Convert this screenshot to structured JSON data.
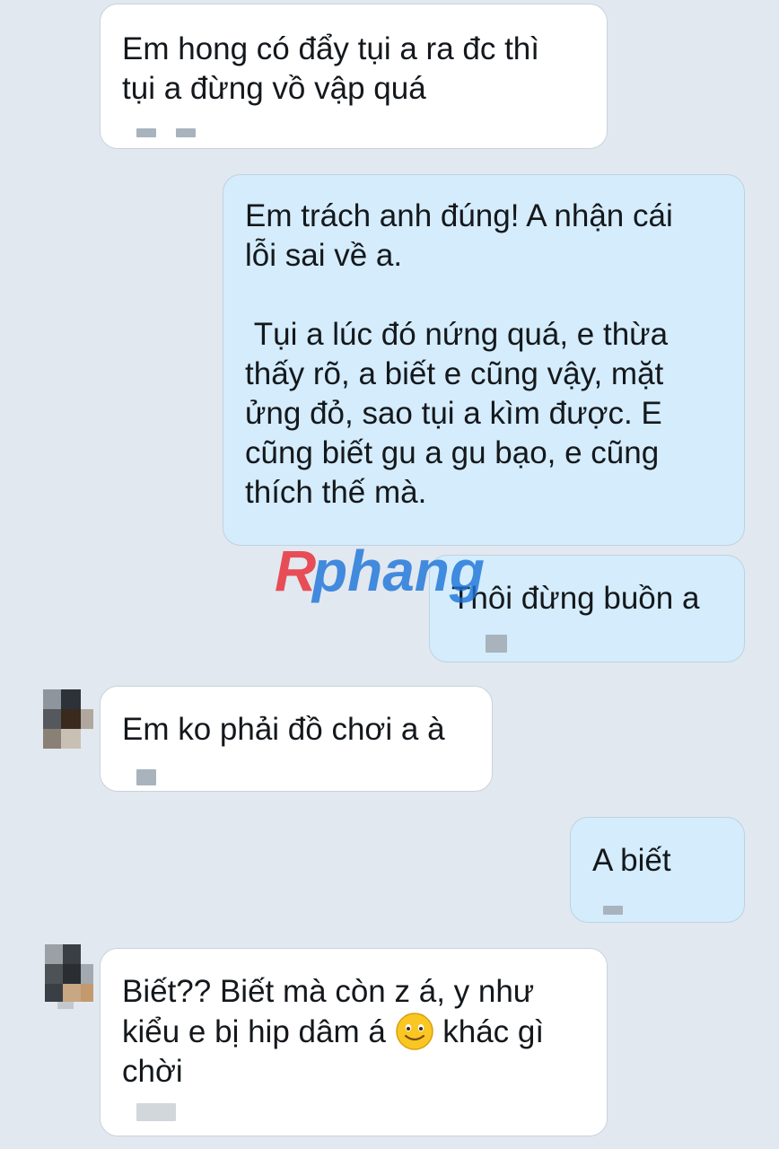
{
  "watermark": {
    "text": "Rphang"
  },
  "messages": [
    {
      "id": "m1",
      "direction": "incoming",
      "text": "Em hong có đẩy tụi a ra đc thì\ntụi a đừng vồ vập quá"
    },
    {
      "id": "m2",
      "direction": "outgoing",
      "text": "Em trách anh đúng! A nhận cái\nlỗi sai về a.\n\n Tụi a lúc đó nứng quá, e thừa\nthấy rõ, a biết e cũng vậy, mặt\nửng đỏ, sao tụi a kìm được. E\ncũng biết gu a gu bạo, e cũng\nthích thế mà."
    },
    {
      "id": "m3",
      "direction": "outgoing",
      "text": "Thôi đừng buồn a"
    },
    {
      "id": "m4",
      "direction": "incoming",
      "text": "Em ko phải đồ chơi a à"
    },
    {
      "id": "m5",
      "direction": "outgoing",
      "text": "A biết"
    },
    {
      "id": "m6",
      "direction": "incoming",
      "text_part1": "Biết?? Biết mà còn z á, y như\nkiểu e bị hip dâm á ",
      "emoji": "smiling-face-emoji",
      "text_part2": " khác gì\nchời"
    }
  ],
  "colors": {
    "background": "#e2e8ef",
    "incoming_bubble": "#ffffff",
    "outgoing_bubble": "#d4ecfb",
    "text": "#14181c",
    "watermark_red": "#e8323c",
    "watermark_blue": "#1a73d9"
  }
}
